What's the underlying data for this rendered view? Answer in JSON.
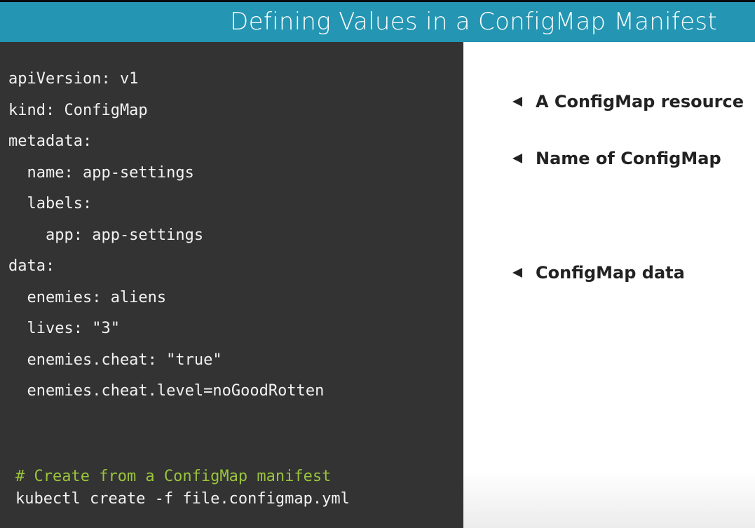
{
  "header": {
    "title": "Defining Values in a ConfigMap Manifest"
  },
  "code": {
    "lines": [
      "apiVersion: v1",
      "kind: ConfigMap",
      "metadata:",
      "  name: app-settings",
      "  labels:",
      "    app: app-settings",
      "data:",
      "  enemies: aliens",
      "  lives: \"3\"",
      "  enemies.cheat: \"true\"",
      "  enemies.cheat.level=noGoodRotten"
    ],
    "comment": "# Create from a ConfigMap manifest",
    "command": "kubectl create -f file.configmap.yml"
  },
  "annotations": [
    {
      "text": "A ConfigMap resource",
      "icon": "left-triangle-icon"
    },
    {
      "text": "Name of ConfigMap",
      "icon": "left-triangle-icon"
    },
    {
      "text": "ConfigMap data",
      "icon": "left-triangle-icon"
    }
  ],
  "colors": {
    "header_bg": "#2496b3",
    "code_bg": "#333333",
    "code_text": "#f2f2f2",
    "comment_text": "#9ac43c",
    "annotation_text": "#222222"
  }
}
